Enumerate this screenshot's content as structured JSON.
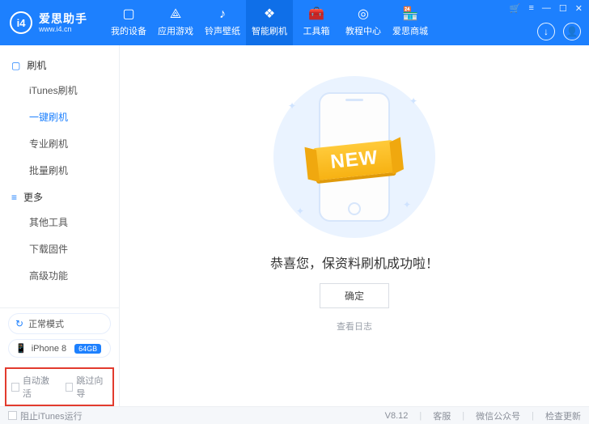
{
  "app": {
    "title": "爱思助手",
    "url": "www.i4.cn",
    "logo_mark": "i4"
  },
  "window_controls": {
    "cart": "🛒",
    "menu": "≡",
    "min": "—",
    "max": "☐",
    "close": "✕"
  },
  "top_circles": {
    "download": "↓",
    "user": "👤"
  },
  "nav": [
    {
      "icon": "▢",
      "label": "我的设备"
    },
    {
      "icon": "⟁",
      "label": "应用游戏"
    },
    {
      "icon": "♪",
      "label": "铃声壁纸"
    },
    {
      "icon": "❖",
      "label": "智能刷机",
      "active": true
    },
    {
      "icon": "🧰",
      "label": "工具箱"
    },
    {
      "icon": "◎",
      "label": "教程中心"
    },
    {
      "icon": "🏪",
      "label": "爱思商城"
    }
  ],
  "sidebar": {
    "group1_icon": "▢",
    "group1_label": "刷机",
    "items1": [
      "iTunes刷机",
      "一键刷机",
      "专业刷机",
      "批量刷机"
    ],
    "active_index": 1,
    "group2_icon": "≡",
    "group2_label": "更多",
    "items2": [
      "其他工具",
      "下载固件",
      "高级功能"
    ],
    "mode": {
      "icon": "↻",
      "label": "正常模式"
    },
    "device": {
      "icon": "📱",
      "name": "iPhone 8",
      "storage": "64GB"
    },
    "checks": {
      "auto_activate": "自动激活",
      "skip_guide": "跳过向导"
    }
  },
  "main": {
    "ribbon": "NEW",
    "success": "恭喜您，保资料刷机成功啦！",
    "ok": "确定",
    "view_log": "查看日志"
  },
  "status": {
    "prevent_itunes": "阻止iTunes运行",
    "version": "V8.12",
    "support": "客服",
    "wechat": "微信公众号",
    "update": "检查更新"
  }
}
